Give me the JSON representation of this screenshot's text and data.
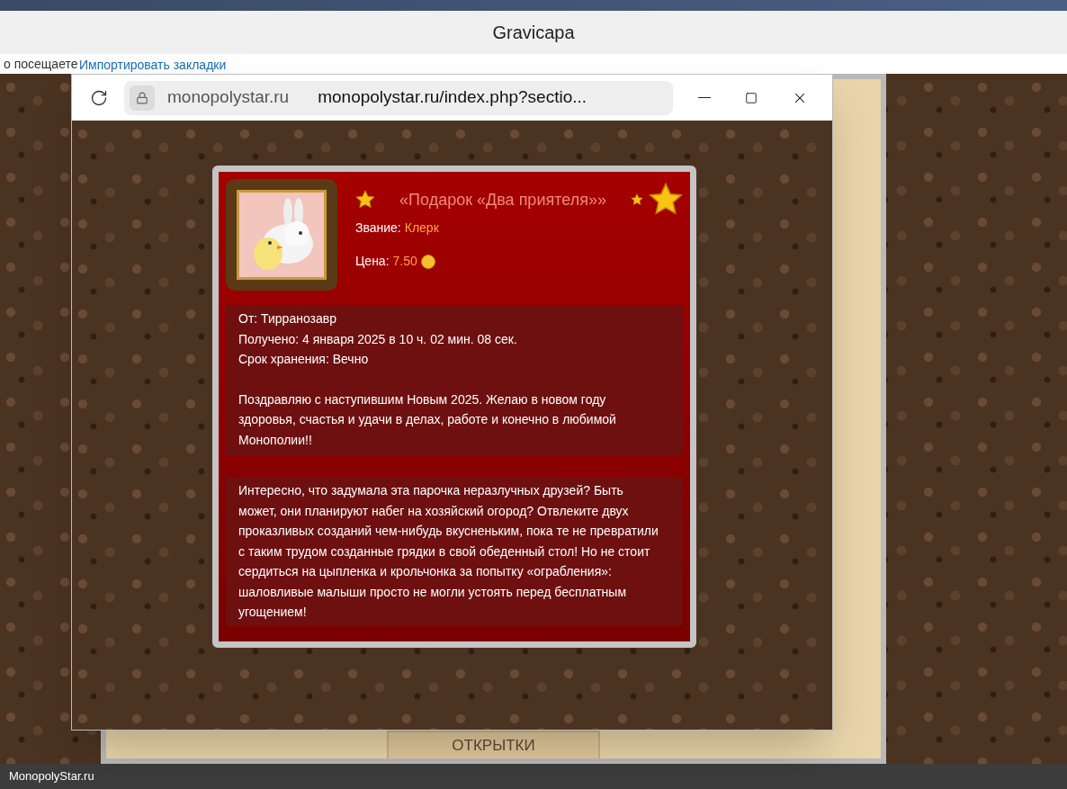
{
  "browser": {
    "title": "Gravicapa",
    "bookmarks_text": "о посещаете",
    "bookmarks_link": "Импортировать закладки"
  },
  "popup": {
    "site": "monopolystar.ru",
    "url": "monopolystar.ru/index.php?sectio..."
  },
  "gift": {
    "title": "«Подарок «Два приятеля»»",
    "rank_label": "Звание:",
    "rank": "Клерк",
    "price_label": "Цена:",
    "price": "7.50",
    "details": [
      "От: Тирранозавр",
      "Получено: 4 января 2025 в 10 ч. 02 мин. 08 сек.",
      "Срок хранения: Вечно"
    ],
    "message": "Поздравляю с наступившим Новым 2025. Желаю в новом году здоровья, счастья и удачи в делах, работе и конечно в любимой Монополии!!",
    "description": "Интересно, что задумала эта парочка неразлучных друзей? Быть может, они планируют набег на хозяйский огород? Отвлеките двух проказливых созданий чем-нибудь вкусненьким, пока те не превратили с таким трудом созданные грядки в свой обеденный стол! Но не стоит сердиться на цыпленка и крольчонка за попытку «ограбления»: шаловливые малыши просто не могли устоять перед бесплатным угощением!"
  },
  "page": {
    "section_title": "ОТКРЫТКИ"
  },
  "status_bar": {
    "text": "MonopolyStar.ru"
  }
}
